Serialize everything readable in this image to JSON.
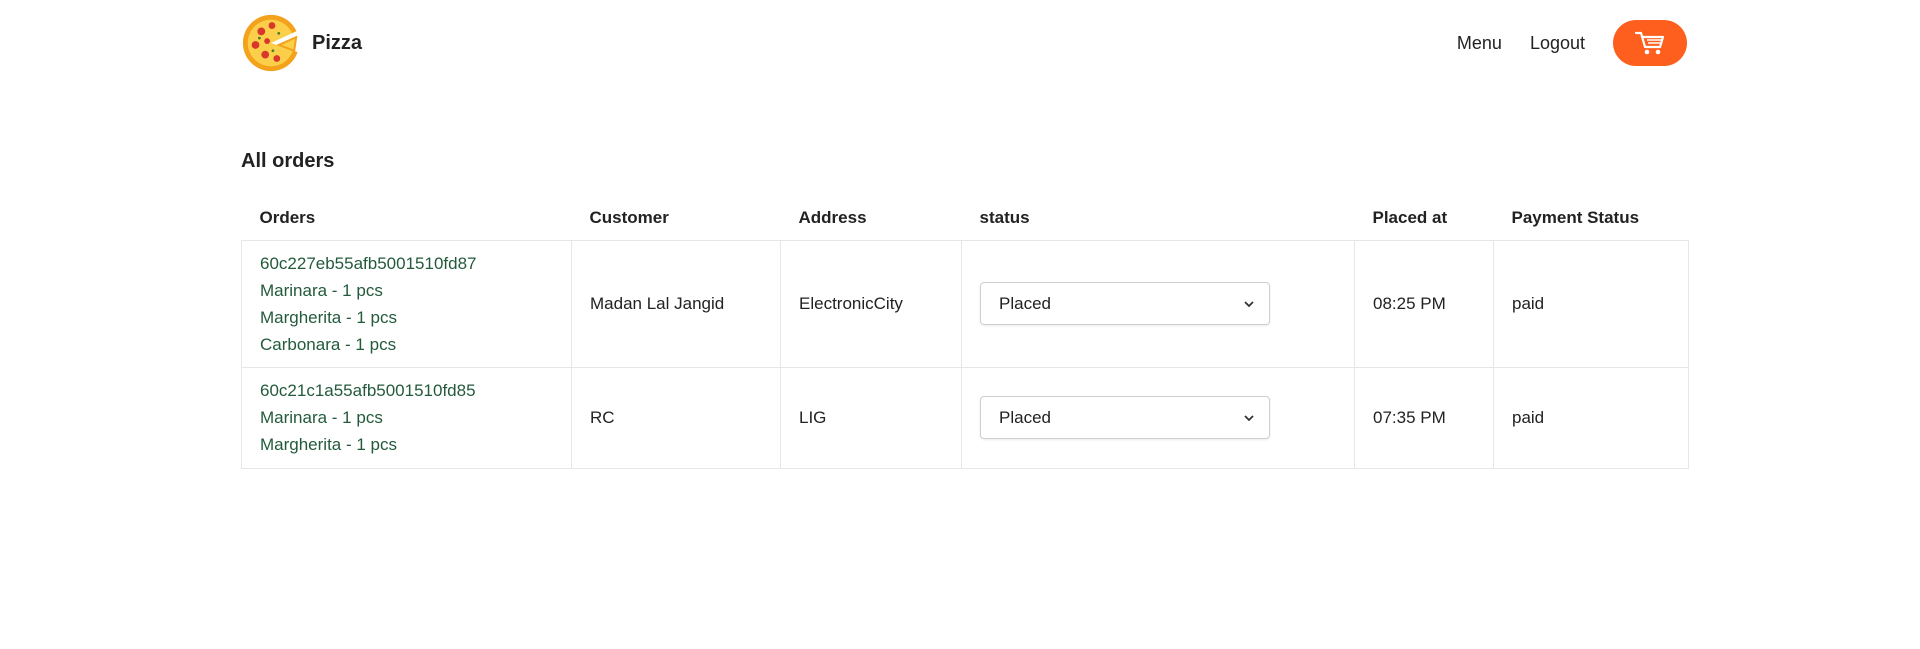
{
  "brand": {
    "name": "Pizza"
  },
  "nav": {
    "menu": "Menu",
    "logout": "Logout",
    "cart_icon": "cart-icon"
  },
  "page": {
    "title": "All orders"
  },
  "table": {
    "headers": [
      "Orders",
      "Customer",
      "Address",
      "status",
      "Placed at",
      "Payment Status"
    ],
    "rows": [
      {
        "order_id": "60c227eb55afb5001510fd87",
        "items": [
          "Marinara - 1 pcs",
          "Margherita - 1 pcs",
          "Carbonara - 1 pcs"
        ],
        "customer": "Madan Lal Jangid",
        "address": "ElectronicCity",
        "status": "Placed",
        "placed_at": "08:25 PM",
        "payment_status": "paid"
      },
      {
        "order_id": "60c21c1a55afb5001510fd85",
        "items": [
          "Marinara - 1 pcs",
          "Margherita - 1 pcs"
        ],
        "customer": "RC",
        "address": "LIG",
        "status": "Placed",
        "placed_at": "07:35 PM",
        "payment_status": "paid"
      }
    ]
  },
  "colors": {
    "accent": "#fe5f1e",
    "order_text": "#235a3c"
  }
}
